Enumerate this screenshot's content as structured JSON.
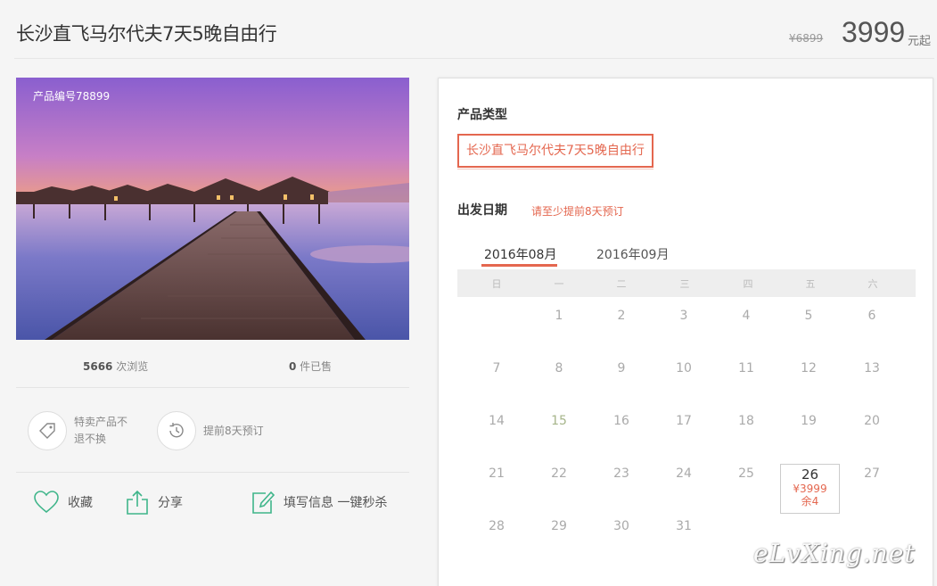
{
  "header": {
    "title": "长沙直飞马尔代夫7天5晚自由行",
    "original_price": "¥6899",
    "price": "3999",
    "price_unit": "元起"
  },
  "gallery": {
    "product_no": "产品编号78899"
  },
  "stats": {
    "views_count": "5666",
    "views_label": " 次浏览",
    "sold_count": "0",
    "sold_label": " 件已售"
  },
  "features": [
    {
      "icon": "tag-icon",
      "text": "特卖产品不退不换"
    },
    {
      "icon": "clock-history-icon",
      "text": "提前8天预订"
    }
  ],
  "actions": {
    "favorite": "收藏",
    "share": "分享",
    "fill_info": "填写信息 一键秒杀"
  },
  "booking": {
    "type_label": "产品类型",
    "type_option": "长沙直飞马尔代夫7天5晚自由行",
    "date_label": "出发日期",
    "date_hint": "请至少提前8天预订",
    "months": [
      "2016年08月",
      "2016年09月"
    ],
    "active_month": "2016年08月",
    "weekdays": [
      "日",
      "一",
      "二",
      "三",
      "四",
      "五",
      "六"
    ],
    "weeks": [
      [
        "",
        "1",
        "2",
        "3",
        "4",
        "5",
        "6"
      ],
      [
        "7",
        "8",
        "9",
        "10",
        "11",
        "12",
        "13"
      ],
      [
        "14",
        "15",
        "16",
        "17",
        "18",
        "19",
        "20"
      ],
      [
        "21",
        "22",
        "23",
        "24",
        "25",
        "26",
        "27"
      ],
      [
        "28",
        "29",
        "30",
        "31",
        "",
        "",
        ""
      ]
    ],
    "selected_day": {
      "day": "26",
      "price": "¥3999",
      "remaining": "余4"
    }
  },
  "watermark": "eLvXing.net",
  "colors": {
    "accent": "#e4674f",
    "icon_green": "#3fb58a"
  }
}
